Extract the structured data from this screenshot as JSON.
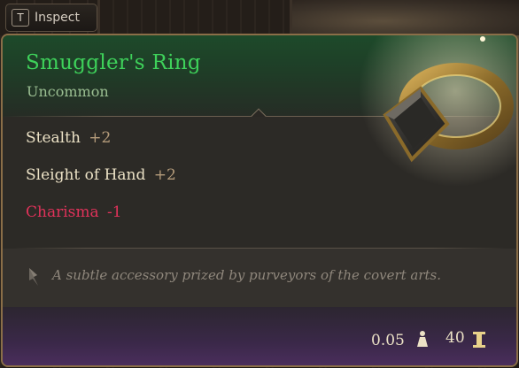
{
  "inspect": {
    "key": "T",
    "label": "Inspect"
  },
  "item": {
    "name": "Smuggler's Ring",
    "rarity": "Uncommon",
    "name_color": "#3ed15a",
    "icon": "ring-icon"
  },
  "stats": [
    {
      "name": "Stealth",
      "bonus": "+2",
      "negative": false
    },
    {
      "name": "Sleight of Hand",
      "bonus": "+2",
      "negative": false
    },
    {
      "name": "Charisma",
      "bonus": "-1",
      "negative": true
    }
  ],
  "description": "A subtle accessory prized by purveyors of the covert arts.",
  "footer": {
    "weight": "0.05",
    "weight_icon": "weight-icon",
    "price": "40",
    "price_icon": "gold-coin-icon"
  },
  "colors": {
    "positive_stat": "#ece2c6",
    "negative_stat": "#e0325a",
    "border": "#8a6e48"
  }
}
